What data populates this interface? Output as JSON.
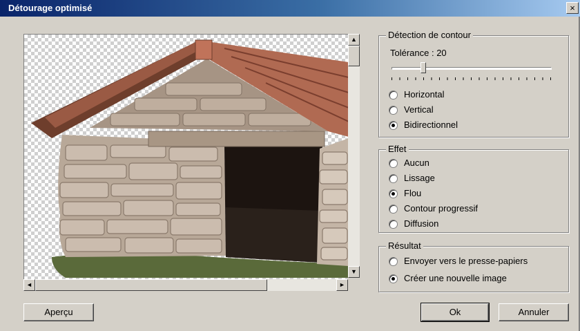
{
  "window": {
    "title": "Détourage optimisé",
    "close_glyph": "×"
  },
  "contour": {
    "legend": "Détection de contour",
    "tolerance_label": "Tolérance : 20",
    "tolerance_value": 20,
    "options": [
      {
        "label": "Horizontal",
        "selected": false
      },
      {
        "label": "Vertical",
        "selected": false
      },
      {
        "label": "Bidirectionnel",
        "selected": true
      }
    ]
  },
  "effet": {
    "legend": "Effet",
    "options": [
      {
        "label": "Aucun",
        "selected": false
      },
      {
        "label": "Lissage",
        "selected": false
      },
      {
        "label": "Flou",
        "selected": true
      },
      {
        "label": "Contour progressif",
        "selected": false
      },
      {
        "label": "Diffusion",
        "selected": false
      }
    ]
  },
  "resultat": {
    "legend": "Résultat",
    "options": [
      {
        "label": "Envoyer vers le presse-papiers",
        "selected": false
      },
      {
        "label": "Créer une nouvelle image",
        "selected": true
      }
    ]
  },
  "buttons": {
    "apercu": "Aperçu",
    "ok": "Ok",
    "annuler": "Annuler"
  },
  "scroll_glyphs": {
    "up": "▲",
    "down": "▼",
    "left": "◄",
    "right": "►"
  },
  "colors": {
    "title_start": "#0a246a",
    "title_end": "#a6caf0",
    "face": "#d4d0c8"
  }
}
